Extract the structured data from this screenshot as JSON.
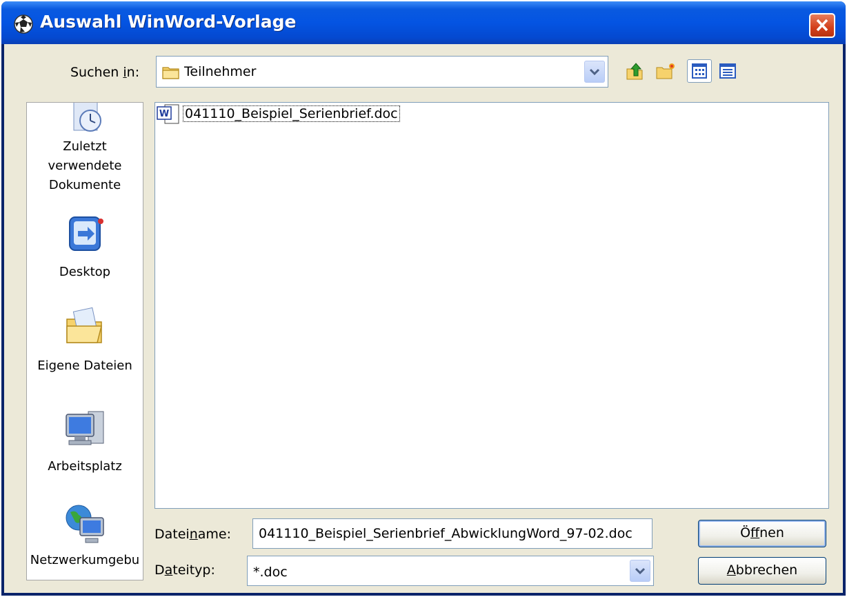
{
  "window": {
    "title": "Auswahl WinWord-Vorlage"
  },
  "look_in": {
    "label_pre": "Suchen ",
    "label_access": "i",
    "label_post": "n:",
    "folder": "Teilnehmer"
  },
  "toolbar": {
    "items": [
      "up-one-level-icon",
      "new-folder-icon",
      "view-list-icon",
      "view-details-icon"
    ]
  },
  "places": [
    {
      "label_lines": [
        "Zuletzt",
        "verwendete",
        "Dokumente"
      ],
      "icon": "recent-documents-icon"
    },
    {
      "label_lines": [
        "Desktop"
      ],
      "icon": "desktop-icon"
    },
    {
      "label_lines": [
        "Eigene Dateien"
      ],
      "icon": "my-documents-icon"
    },
    {
      "label_lines": [
        "Arbeitsplatz"
      ],
      "icon": "my-computer-icon"
    },
    {
      "label_lines": [
        "Netzwerkumgebu"
      ],
      "icon": "network-places-icon"
    }
  ],
  "files": [
    {
      "name": "041110_Beispiel_Serienbrief.doc",
      "icon": "word-document-icon"
    }
  ],
  "filename": {
    "label_pre": "Datei",
    "label_access": "n",
    "label_post": "ame:",
    "value": "041110_Beispiel_Serienbrief_AbwicklungWord_97-02.doc"
  },
  "filetype": {
    "label_pre": "D",
    "label_access": "a",
    "label_post": "teityp:",
    "value": "*.doc"
  },
  "buttons": {
    "open_access": "f",
    "open_pre": "Ö",
    "open_post": "fnen",
    "cancel_access": "A",
    "cancel_post": "bbrechen"
  },
  "colors": {
    "titlebar": "#0454e2",
    "dialog_bg": "#ece9d8",
    "close_button": "#d2401c"
  }
}
